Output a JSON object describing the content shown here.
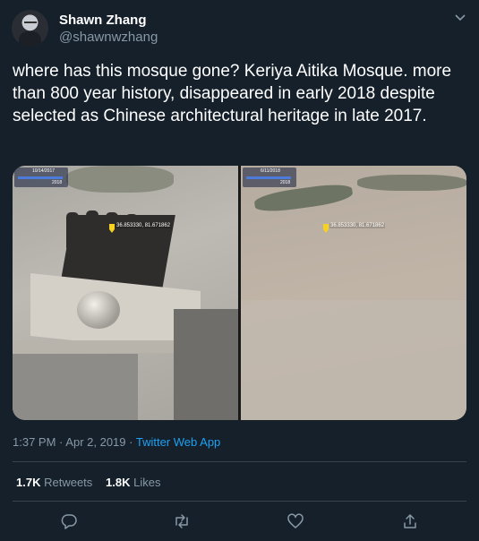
{
  "author": {
    "name": "Shawn Zhang",
    "handle": "@shawnwzhang"
  },
  "tweet": {
    "text": "where has this mosque gone? Keriya Aitika Mosque. more than 800 year history, disappeared in early 2018 despite selected as Chinese architectural heritage in late 2017."
  },
  "media": {
    "left": {
      "date": "10/14/2017",
      "year": "2018",
      "coords": "36.853330, 81.671862"
    },
    "right": {
      "date": "6/11/2018",
      "year": "2018",
      "coords": "36.853330, 81.671862"
    }
  },
  "meta": {
    "time": "1:37 PM",
    "date": "Apr 2, 2019",
    "separator": "·",
    "app": "Twitter Web App"
  },
  "stats": {
    "retweets_count": "1.7K",
    "retweets_label": "Retweets",
    "likes_count": "1.8K",
    "likes_label": "Likes"
  },
  "icons": {
    "reply": "reply-icon",
    "retweet": "retweet-icon",
    "like": "like-icon",
    "share": "share-icon",
    "caret": "chevron-down-icon"
  },
  "colors": {
    "background": "#15202b",
    "secondary_text": "#8899a6",
    "link": "#1da1f2",
    "divider": "#38444d"
  }
}
